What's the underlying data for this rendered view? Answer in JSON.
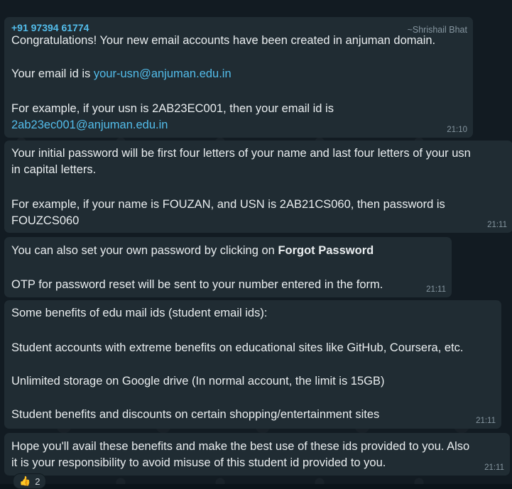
{
  "messages": [
    {
      "sender": "+91 97394 61774",
      "pushname": "~Shrishail Bhat",
      "line1": "Congratulations! Your new email accounts have been created in anjuman domain.",
      "line2_prefix": "Your email id is ",
      "line2_link": "your-usn@anjuman.edu.in",
      "line3": "For example, if your usn is 2AB23EC001, then your email id is",
      "line4_link": "2ab23ec001@anjuman.edu.in",
      "time": "21:10"
    },
    {
      "line1": "Your initial password will be first four letters of your name and last four letters of your usn",
      "line2": "in capital letters.",
      "line3": "For example, if your name is FOUZAN, and USN is 2AB21CS060, then password is",
      "line4": "FOUZCS060",
      "time": "21:11"
    },
    {
      "line1_prefix": "You can also set your own password by clicking on ",
      "line1_bold": "Forgot Password",
      "line2": "OTP for password reset will be sent to your number entered in the form.",
      "time": "21:11"
    },
    {
      "line1": "Some benefits of edu mail ids (student email ids):",
      "line2": "Student accounts with extreme benefits on educational sites like GitHub, Coursera, etc.",
      "line3": "Unlimited storage on Google drive (In normal account, the limit is 15GB)",
      "line4": "Student benefits and discounts on certain shopping/entertainment sites",
      "time": "21:11"
    },
    {
      "line1": "Hope you'll avail these benefits and make the best use of these ids provided to you. Also",
      "line2": "it is your responsibility to avoid misuse of this student id provided to you.",
      "time": "21:11"
    }
  ],
  "reaction": {
    "emoji": "👍",
    "count": "2"
  },
  "colors": {
    "bubble": "#202c33",
    "link": "#53bdeb",
    "meta": "#8696a0",
    "text": "#e9edef"
  }
}
